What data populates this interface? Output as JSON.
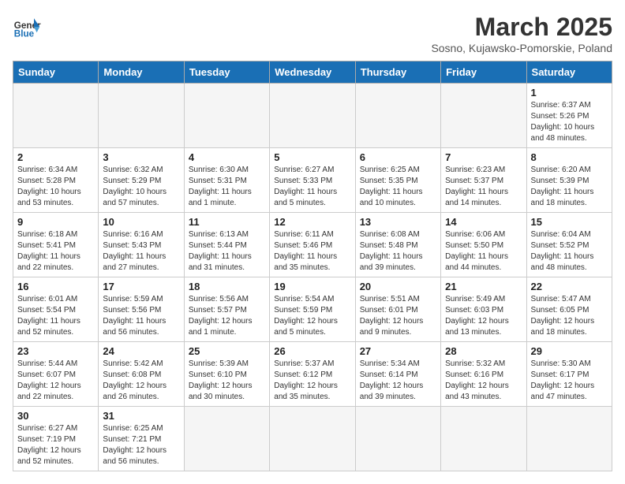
{
  "header": {
    "logo_general": "General",
    "logo_blue": "Blue",
    "month_title": "March 2025",
    "subtitle": "Sosno, Kujawsko-Pomorskie, Poland"
  },
  "days_of_week": [
    "Sunday",
    "Monday",
    "Tuesday",
    "Wednesday",
    "Thursday",
    "Friday",
    "Saturday"
  ],
  "weeks": [
    [
      {
        "day": "",
        "info": ""
      },
      {
        "day": "",
        "info": ""
      },
      {
        "day": "",
        "info": ""
      },
      {
        "day": "",
        "info": ""
      },
      {
        "day": "",
        "info": ""
      },
      {
        "day": "",
        "info": ""
      },
      {
        "day": "1",
        "info": "Sunrise: 6:37 AM\nSunset: 5:26 PM\nDaylight: 10 hours\nand 48 minutes."
      }
    ],
    [
      {
        "day": "2",
        "info": "Sunrise: 6:34 AM\nSunset: 5:28 PM\nDaylight: 10 hours\nand 53 minutes."
      },
      {
        "day": "3",
        "info": "Sunrise: 6:32 AM\nSunset: 5:29 PM\nDaylight: 10 hours\nand 57 minutes."
      },
      {
        "day": "4",
        "info": "Sunrise: 6:30 AM\nSunset: 5:31 PM\nDaylight: 11 hours\nand 1 minute."
      },
      {
        "day": "5",
        "info": "Sunrise: 6:27 AM\nSunset: 5:33 PM\nDaylight: 11 hours\nand 5 minutes."
      },
      {
        "day": "6",
        "info": "Sunrise: 6:25 AM\nSunset: 5:35 PM\nDaylight: 11 hours\nand 10 minutes."
      },
      {
        "day": "7",
        "info": "Sunrise: 6:23 AM\nSunset: 5:37 PM\nDaylight: 11 hours\nand 14 minutes."
      },
      {
        "day": "8",
        "info": "Sunrise: 6:20 AM\nSunset: 5:39 PM\nDaylight: 11 hours\nand 18 minutes."
      }
    ],
    [
      {
        "day": "9",
        "info": "Sunrise: 6:18 AM\nSunset: 5:41 PM\nDaylight: 11 hours\nand 22 minutes."
      },
      {
        "day": "10",
        "info": "Sunrise: 6:16 AM\nSunset: 5:43 PM\nDaylight: 11 hours\nand 27 minutes."
      },
      {
        "day": "11",
        "info": "Sunrise: 6:13 AM\nSunset: 5:44 PM\nDaylight: 11 hours\nand 31 minutes."
      },
      {
        "day": "12",
        "info": "Sunrise: 6:11 AM\nSunset: 5:46 PM\nDaylight: 11 hours\nand 35 minutes."
      },
      {
        "day": "13",
        "info": "Sunrise: 6:08 AM\nSunset: 5:48 PM\nDaylight: 11 hours\nand 39 minutes."
      },
      {
        "day": "14",
        "info": "Sunrise: 6:06 AM\nSunset: 5:50 PM\nDaylight: 11 hours\nand 44 minutes."
      },
      {
        "day": "15",
        "info": "Sunrise: 6:04 AM\nSunset: 5:52 PM\nDaylight: 11 hours\nand 48 minutes."
      }
    ],
    [
      {
        "day": "16",
        "info": "Sunrise: 6:01 AM\nSunset: 5:54 PM\nDaylight: 11 hours\nand 52 minutes."
      },
      {
        "day": "17",
        "info": "Sunrise: 5:59 AM\nSunset: 5:56 PM\nDaylight: 11 hours\nand 56 minutes."
      },
      {
        "day": "18",
        "info": "Sunrise: 5:56 AM\nSunset: 5:57 PM\nDaylight: 12 hours\nand 1 minute."
      },
      {
        "day": "19",
        "info": "Sunrise: 5:54 AM\nSunset: 5:59 PM\nDaylight: 12 hours\nand 5 minutes."
      },
      {
        "day": "20",
        "info": "Sunrise: 5:51 AM\nSunset: 6:01 PM\nDaylight: 12 hours\nand 9 minutes."
      },
      {
        "day": "21",
        "info": "Sunrise: 5:49 AM\nSunset: 6:03 PM\nDaylight: 12 hours\nand 13 minutes."
      },
      {
        "day": "22",
        "info": "Sunrise: 5:47 AM\nSunset: 6:05 PM\nDaylight: 12 hours\nand 18 minutes."
      }
    ],
    [
      {
        "day": "23",
        "info": "Sunrise: 5:44 AM\nSunset: 6:07 PM\nDaylight: 12 hours\nand 22 minutes."
      },
      {
        "day": "24",
        "info": "Sunrise: 5:42 AM\nSunset: 6:08 PM\nDaylight: 12 hours\nand 26 minutes."
      },
      {
        "day": "25",
        "info": "Sunrise: 5:39 AM\nSunset: 6:10 PM\nDaylight: 12 hours\nand 30 minutes."
      },
      {
        "day": "26",
        "info": "Sunrise: 5:37 AM\nSunset: 6:12 PM\nDaylight: 12 hours\nand 35 minutes."
      },
      {
        "day": "27",
        "info": "Sunrise: 5:34 AM\nSunset: 6:14 PM\nDaylight: 12 hours\nand 39 minutes."
      },
      {
        "day": "28",
        "info": "Sunrise: 5:32 AM\nSunset: 6:16 PM\nDaylight: 12 hours\nand 43 minutes."
      },
      {
        "day": "29",
        "info": "Sunrise: 5:30 AM\nSunset: 6:17 PM\nDaylight: 12 hours\nand 47 minutes."
      }
    ],
    [
      {
        "day": "30",
        "info": "Sunrise: 6:27 AM\nSunset: 7:19 PM\nDaylight: 12 hours\nand 52 minutes."
      },
      {
        "day": "31",
        "info": "Sunrise: 6:25 AM\nSunset: 7:21 PM\nDaylight: 12 hours\nand 56 minutes."
      },
      {
        "day": "",
        "info": ""
      },
      {
        "day": "",
        "info": ""
      },
      {
        "day": "",
        "info": ""
      },
      {
        "day": "",
        "info": ""
      },
      {
        "day": "",
        "info": ""
      }
    ]
  ]
}
